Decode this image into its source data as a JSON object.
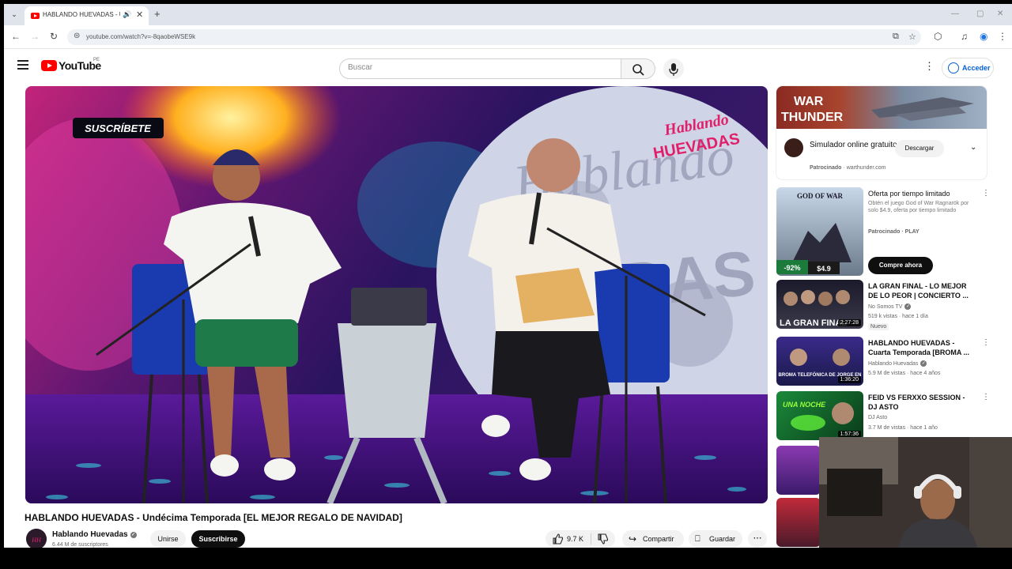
{
  "browser": {
    "tab_title": "HABLANDO HUEVADAS - U",
    "url": "youtube.com/watch?v=-8qaobeWSE9k"
  },
  "header": {
    "logo_text": "YouTube",
    "country_code": "PE",
    "search_placeholder": "Buscar",
    "signin_label": "Acceder"
  },
  "video": {
    "overlay_subscribe": "SUSCRÍBETE",
    "overlay_brand_top": "Hablando",
    "overlay_brand_bottom": "HUEVADAS",
    "title": "HABLANDO HUEVADAS - Undécima Temporada [EL MEJOR REGALO DE NAVIDAD]",
    "channel": "Hablando Huevadas",
    "subscribers": "6.44 M de suscriptores",
    "join_label": "Unirse",
    "subscribe_label": "Suscribirse",
    "likes": "9.7 K",
    "share_label": "Compartir",
    "save_label": "Guardar"
  },
  "ad": {
    "banner_line1": "WAR",
    "banner_line2": "THUNDER",
    "title": "Simulador online gratuito",
    "sponsored": "Patrocinado",
    "domain": "warthunder.com",
    "cta": "Descargar"
  },
  "recommendations": [
    {
      "title": "Oferta por tiempo limitado",
      "desc": "Obtén el juego God of War Ragnarök por solo $4.9, oferta por tiempo limitado",
      "channel": "Patrocinado · PLAY",
      "views": "",
      "badge": "",
      "duration": "",
      "discount": "-92%",
      "price": "$4.9",
      "thumb_caption": "GOD OF WAR",
      "button": "Compre ahora"
    },
    {
      "title": "LA GRAN FINAL - LO MEJOR DE LO PEOR | CONCIERTO ...",
      "channel": "No Somos TV",
      "views": "519 k vistas · hace 1 día",
      "badge": "Nuevo",
      "duration": "2:27:28",
      "thumb_caption": "LA GRAN FINAL"
    },
    {
      "title": "HABLANDO HUEVADAS - Cuarta Temporada [BROMA ...",
      "channel": "Hablando Huevadas",
      "views": "5.9 M de vistas · hace 4 años",
      "badge": "",
      "duration": "1:36:20",
      "thumb_caption": "BROMA TELEFÓNICA DE JORGE EN"
    },
    {
      "title": "FEID VS FERXXO SESSION - DJ ASTO",
      "channel": "DJ Asto",
      "views": "3.7 M de vistas · hace 1 año",
      "badge": "",
      "duration": "1:57:36",
      "thumb_caption": "UNA NOCHE"
    }
  ],
  "colors": {
    "yt_red": "#ff0000",
    "link_blue": "#065fd4"
  }
}
